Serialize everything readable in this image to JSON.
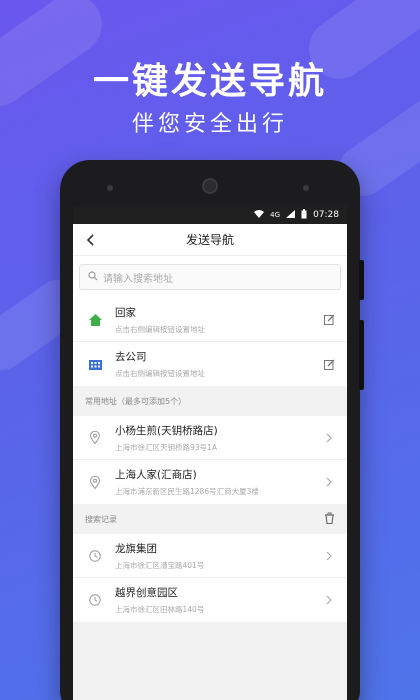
{
  "promo": {
    "headline": "一键发送导航",
    "subline": "伴您安全出行"
  },
  "status_bar": {
    "time": "07:28",
    "network": "4G"
  },
  "nav": {
    "title": "发送导航"
  },
  "search": {
    "placeholder": "请输入搜索地址"
  },
  "shortcuts": [
    {
      "label": "回家",
      "hint": "点击右侧编辑按钮设置地址",
      "icon": "home-icon"
    },
    {
      "label": "去公司",
      "hint": "点击右侧编辑按钮设置地址",
      "icon": "building-icon"
    }
  ],
  "frequent": {
    "header": "常用地址（最多可添加5个）",
    "items": [
      {
        "name": "小杨生煎(天钥桥路店)",
        "address": "上海市徐汇区天钥桥路93号1A"
      },
      {
        "name": "上海人家(汇商店)",
        "address": "上海市浦东新区民生路1286号汇商大厦3楼"
      }
    ]
  },
  "history": {
    "header": "搜索记录",
    "items": [
      {
        "name": "龙旗集团",
        "address": "上海市徐汇区漕宝路401号"
      },
      {
        "name": "越界创意园区",
        "address": "上海市徐汇区田林路140号"
      }
    ]
  },
  "colors": {
    "home_icon": "#3fae49",
    "building_icon": "#3b6fd8",
    "accent_bg": "#5a63ea"
  }
}
